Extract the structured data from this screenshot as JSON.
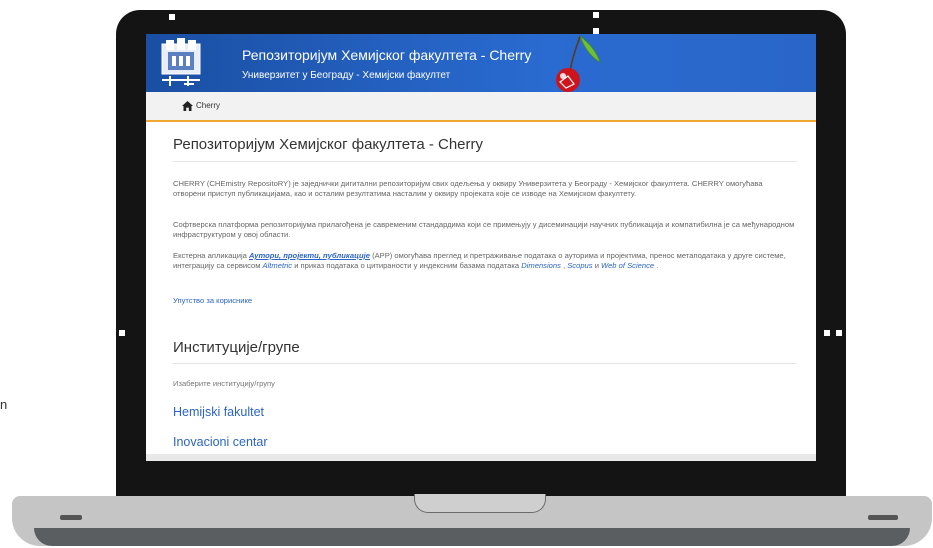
{
  "stray_text": "n",
  "header": {
    "title": "Репозиторијум Хемијског факултета - Cherry",
    "subtitle": "Универзитет у Београду - Хемијски факултет",
    "colors": {
      "primary": "#2a6bd1",
      "accent": "#f0a830",
      "link": "#2b64c6"
    }
  },
  "breadcrumb": {
    "home_icon": "home-icon",
    "label": "Cherry"
  },
  "main": {
    "title": "Репозиторијум Хемијског факултета - Cherry",
    "paragraphs": {
      "p1": "CHERRY (CHEmistry RepositoRY) је заједнички дигитални репозиторијум свих одељења у оквиру Универзитета у Београду - Хемијског факултета. CHERRY омогућава отворени приступ публикацијама, као и осталим резултатима насталим у оквиру пројеката које се изводе на Хемијском факултету.",
      "p2": "Софтверска платформа репозиторијума прилагођена је савременим стандардима који се примењују у дисеминацији научних публикација и компатибилна је са међународном инфраструктуром у овој области.",
      "p3_before": "Екстерна апликација ",
      "p3_link": "Аутори, пројекти, публикације",
      "p3_mid1": " (APP) омогућава преглед и претраживање података о ауторима и пројектима, пренос метаподатака у друге системе, интеграцију са сервисом ",
      "p3_altmetric": "Altmetric",
      "p3_mid2": " и приказ података о цитираности у индексним базама података ",
      "p3_dimensions": "Dimensions",
      "p3_sep1": " , ",
      "p3_scopus": "Scopus",
      "p3_sep2": " и ",
      "p3_wos": "Web of Science",
      "p3_end": " ."
    },
    "guide_link": "Упутство за кориснике"
  },
  "institutions": {
    "title": "Институције/групе",
    "hint": "Изаберите институцију/групу",
    "items": [
      "Hemijski fakultet",
      "Inovacioni centar"
    ]
  }
}
